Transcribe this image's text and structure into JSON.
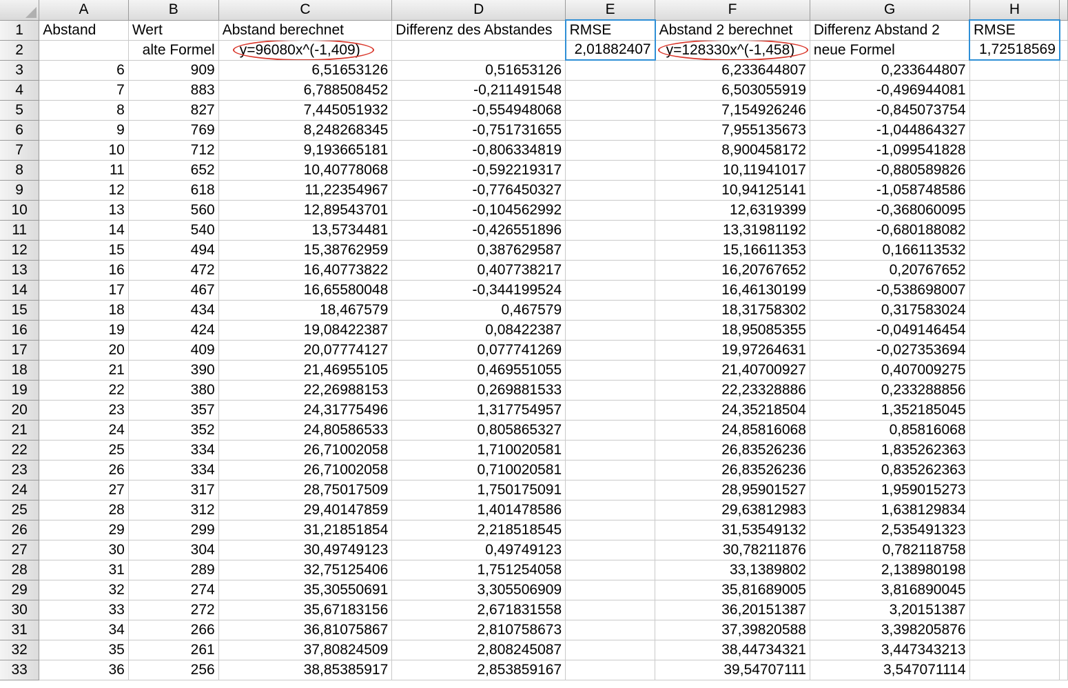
{
  "columns": [
    "A",
    "B",
    "C",
    "D",
    "E",
    "F",
    "G",
    "H"
  ],
  "header_row": {
    "A": "Abstand",
    "B": "Wert",
    "C": "Abstand berechnet",
    "D": "Differenz des Abstandes",
    "E": "RMSE",
    "F": "Abstand 2 berechnet",
    "G": "Differenz Abstand 2",
    "H": "RMSE"
  },
  "second_row": {
    "A": "",
    "B": "alte Formel",
    "C": "y=96080x^(-1,409)",
    "D": "",
    "E": "2,01882407",
    "F": "y=128330x^(-1,458)",
    "G": "neue Formel",
    "H": "1,72518569"
  },
  "data_rows": [
    {
      "r": "3",
      "a": "6",
      "b": "909",
      "c": "6,51653126",
      "d": "0,51653126",
      "f": "6,233644807",
      "g": "0,233644807"
    },
    {
      "r": "4",
      "a": "7",
      "b": "883",
      "c": "6,788508452",
      "d": "-0,211491548",
      "f": "6,503055919",
      "g": "-0,496944081"
    },
    {
      "r": "5",
      "a": "8",
      "b": "827",
      "c": "7,445051932",
      "d": "-0,554948068",
      "f": "7,154926246",
      "g": "-0,845073754"
    },
    {
      "r": "6",
      "a": "9",
      "b": "769",
      "c": "8,248268345",
      "d": "-0,751731655",
      "f": "7,955135673",
      "g": "-1,044864327"
    },
    {
      "r": "7",
      "a": "10",
      "b": "712",
      "c": "9,193665181",
      "d": "-0,806334819",
      "f": "8,900458172",
      "g": "-1,099541828"
    },
    {
      "r": "8",
      "a": "11",
      "b": "652",
      "c": "10,40778068",
      "d": "-0,592219317",
      "f": "10,11941017",
      "g": "-0,880589826"
    },
    {
      "r": "9",
      "a": "12",
      "b": "618",
      "c": "11,22354967",
      "d": "-0,776450327",
      "f": "10,94125141",
      "g": "-1,058748586"
    },
    {
      "r": "10",
      "a": "13",
      "b": "560",
      "c": "12,89543701",
      "d": "-0,104562992",
      "f": "12,6319399",
      "g": "-0,368060095"
    },
    {
      "r": "11",
      "a": "14",
      "b": "540",
      "c": "13,5734481",
      "d": "-0,426551896",
      "f": "13,31981192",
      "g": "-0,680188082"
    },
    {
      "r": "12",
      "a": "15",
      "b": "494",
      "c": "15,38762959",
      "d": "0,387629587",
      "f": "15,16611353",
      "g": "0,166113532"
    },
    {
      "r": "13",
      "a": "16",
      "b": "472",
      "c": "16,40773822",
      "d": "0,407738217",
      "f": "16,20767652",
      "g": "0,20767652"
    },
    {
      "r": "14",
      "a": "17",
      "b": "467",
      "c": "16,65580048",
      "d": "-0,344199524",
      "f": "16,46130199",
      "g": "-0,538698007"
    },
    {
      "r": "15",
      "a": "18",
      "b": "434",
      "c": "18,467579",
      "d": "0,467579",
      "f": "18,31758302",
      "g": "0,317583024"
    },
    {
      "r": "16",
      "a": "19",
      "b": "424",
      "c": "19,08422387",
      "d": "0,08422387",
      "f": "18,95085355",
      "g": "-0,049146454"
    },
    {
      "r": "17",
      "a": "20",
      "b": "409",
      "c": "20,07774127",
      "d": "0,077741269",
      "f": "19,97264631",
      "g": "-0,027353694"
    },
    {
      "r": "18",
      "a": "21",
      "b": "390",
      "c": "21,46955105",
      "d": "0,469551055",
      "f": "21,40700927",
      "g": "0,407009275"
    },
    {
      "r": "19",
      "a": "22",
      "b": "380",
      "c": "22,26988153",
      "d": "0,269881533",
      "f": "22,23328886",
      "g": "0,233288856"
    },
    {
      "r": "20",
      "a": "23",
      "b": "357",
      "c": "24,31775496",
      "d": "1,317754957",
      "f": "24,35218504",
      "g": "1,352185045"
    },
    {
      "r": "21",
      "a": "24",
      "b": "352",
      "c": "24,80586533",
      "d": "0,805865327",
      "f": "24,85816068",
      "g": "0,85816068"
    },
    {
      "r": "22",
      "a": "25",
      "b": "334",
      "c": "26,71002058",
      "d": "1,710020581",
      "f": "26,83526236",
      "g": "1,835262363"
    },
    {
      "r": "23",
      "a": "26",
      "b": "334",
      "c": "26,71002058",
      "d": "0,710020581",
      "f": "26,83526236",
      "g": "0,835262363"
    },
    {
      "r": "24",
      "a": "27",
      "b": "317",
      "c": "28,75017509",
      "d": "1,750175091",
      "f": "28,95901527",
      "g": "1,959015273"
    },
    {
      "r": "25",
      "a": "28",
      "b": "312",
      "c": "29,40147859",
      "d": "1,401478586",
      "f": "29,63812983",
      "g": "1,638129834"
    },
    {
      "r": "26",
      "a": "29",
      "b": "299",
      "c": "31,21851854",
      "d": "2,218518545",
      "f": "31,53549132",
      "g": "2,535491323"
    },
    {
      "r": "27",
      "a": "30",
      "b": "304",
      "c": "30,49749123",
      "d": "0,49749123",
      "f": "30,78211876",
      "g": "0,782118758"
    },
    {
      "r": "28",
      "a": "31",
      "b": "289",
      "c": "32,75125406",
      "d": "1,751254058",
      "f": "33,1389802",
      "g": "2,138980198"
    },
    {
      "r": "29",
      "a": "32",
      "b": "274",
      "c": "35,30550691",
      "d": "3,305506909",
      "f": "35,81689005",
      "g": "3,816890045"
    },
    {
      "r": "30",
      "a": "33",
      "b": "272",
      "c": "35,67183156",
      "d": "2,671831558",
      "f": "36,20151387",
      "g": "3,20151387"
    },
    {
      "r": "31",
      "a": "34",
      "b": "266",
      "c": "36,81075867",
      "d": "2,810758673",
      "f": "37,39820588",
      "g": "3,398205876"
    },
    {
      "r": "32",
      "a": "35",
      "b": "261",
      "c": "37,80824509",
      "d": "2,808245087",
      "f": "38,44734321",
      "g": "3,447343213"
    },
    {
      "r": "33",
      "a": "36",
      "b": "256",
      "c": "38,85385917",
      "d": "2,853859167",
      "f": "39,54707111",
      "g": "3,547071114"
    }
  ],
  "colors": {
    "annotation_red": "#e8463a",
    "ellipse_red": "#d9362a",
    "highlight_blue": "#2e8fd6",
    "header_gray": "#dcdcdc"
  }
}
